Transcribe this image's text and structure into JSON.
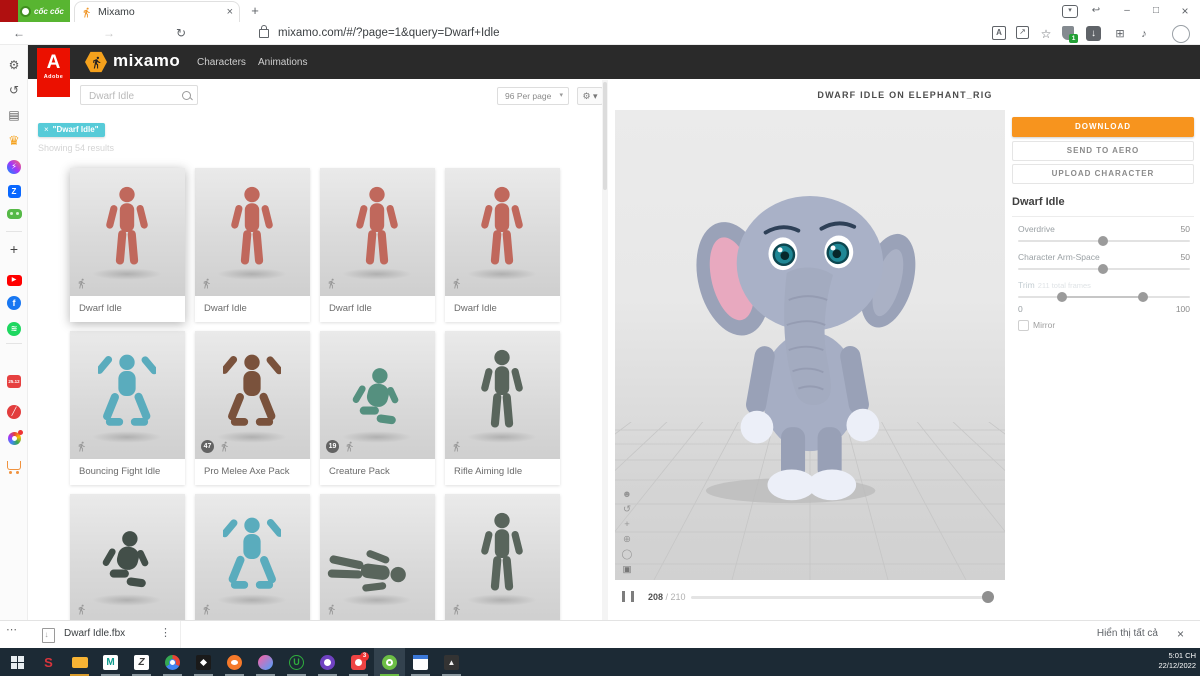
{
  "browser": {
    "brand": "cốc cốc",
    "tab_title": "Mixamo",
    "tab_close": "×",
    "new_tab": "+",
    "url": "mixamo.com/#/?page=1&query=Dwarf+Idle",
    "window": {
      "tab_search": "▾",
      "restore_tab": "↩",
      "minimize": "–",
      "maximize": "□",
      "close": "×"
    },
    "nav": {
      "back": "←",
      "forward": "→",
      "reload": "↻"
    },
    "actions": {
      "translate": "A",
      "share": "↗",
      "star": "☆",
      "shield_badge": "1",
      "download_arrow": "↓",
      "extensions": "⊞",
      "music": "♪"
    }
  },
  "sidebar": {
    "icons": [
      "settings",
      "history",
      "news-feed",
      "rewards",
      "messenger",
      "zalo",
      "games",
      "add",
      "youtube",
      "facebook",
      "spotify",
      "calendar-sale",
      "notes",
      "themes",
      "shopping"
    ],
    "glyphs": {
      "gear": "⚙",
      "history": "↺",
      "feed": "▤",
      "crown": "♛",
      "bolt": "⚡",
      "zalo": "Z",
      "plus": "+",
      "play": "▶",
      "fb": "f",
      "waves": "≋",
      "calendar": "25.12",
      "pencil": "╱"
    }
  },
  "mixamo": {
    "logo": "mixamo",
    "nav_characters": "Characters",
    "nav_animations": "Animations"
  },
  "search": {
    "value": "Dwarf Idle",
    "per_page": "96 Per page",
    "chevron": "▾",
    "gear": "⚙ ▾",
    "chip_close": "×",
    "chip_label": "\"Dwarf Idle\"",
    "results": "Showing 54 results"
  },
  "cards": [
    {
      "label": "Dwarf Idle"
    },
    {
      "label": "Dwarf Idle"
    },
    {
      "label": "Dwarf Idle"
    },
    {
      "label": "Dwarf Idle"
    },
    {
      "label": "Bouncing Fight Idle"
    },
    {
      "label": "Pro Melee Axe Pack",
      "badge": "47"
    },
    {
      "label": "Creature Pack",
      "badge": "19"
    },
    {
      "label": "Rifle Aiming Idle"
    },
    {
      "label": ""
    },
    {
      "label": ""
    },
    {
      "label": ""
    },
    {
      "label": ""
    }
  ],
  "preview": {
    "title": "DWARF IDLE ON ELEPHANT_RIG",
    "download": "DOWNLOAD",
    "send_aero": "SEND TO AERO",
    "upload": "UPLOAD CHARACTER",
    "tools": [
      {
        "name": "character",
        "glyph": "☻"
      },
      {
        "name": "rotate",
        "glyph": "↺"
      },
      {
        "name": "pan",
        "glyph": "+"
      },
      {
        "name": "zoom",
        "glyph": "⊕"
      },
      {
        "name": "orbit",
        "glyph": "◯"
      },
      {
        "name": "camera",
        "glyph": "▣"
      }
    ]
  },
  "settings": {
    "title": "Dwarf Idle",
    "close": "×",
    "overdrive_label": "Overdrive",
    "overdrive_value": "50",
    "armspace_label": "Character Arm-Space",
    "armspace_value": "50",
    "trim_label": "Trim",
    "trim_note": "211 total frames",
    "range_min": "0",
    "range_max": "100",
    "mirror_label": "Mirror"
  },
  "playback": {
    "current": "208",
    "divider": " / ",
    "total": "210"
  },
  "downloads": {
    "more": "⋯",
    "filename": "Dwarf Idle.fbx",
    "menu": "⋮",
    "show_all": "Hiển thị tất cả",
    "close": "×"
  },
  "taskbar": {
    "icons": [
      "start",
      "antivirus-s",
      "file-explorer",
      "maya",
      "zbrush",
      "chrome",
      "substance-3d",
      "blender",
      "paint-3d",
      "utorrent",
      "github-desktop",
      "updates",
      "coc-coc",
      "sticky-notes",
      "unity"
    ],
    "badge": "3",
    "time": "5:01 CH",
    "date": "22/12/2022"
  },
  "colors": {
    "accent_orange": "#f7941e",
    "chip_cyan": "#57cbd8",
    "adobe_red": "#eb1000",
    "coccoc_green": "#6cbe45",
    "header_dark": "#2a2a2a",
    "taskbar_dark": "#1c2a35"
  }
}
